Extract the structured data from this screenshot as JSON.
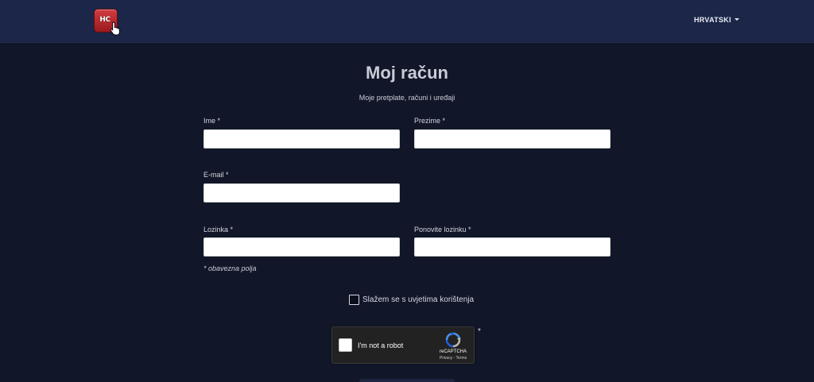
{
  "header": {
    "logo_text": "HC",
    "language_label": "HRVATSKI"
  },
  "page": {
    "title": "Moj račun",
    "subtitle": "Moje pretplate, računi i uređaji"
  },
  "form": {
    "first_name_label": "Ime *",
    "first_name_value": "",
    "last_name_label": "Prezime *",
    "last_name_value": "",
    "email_label": "E-mail *",
    "email_value": "",
    "password_label": "Lozinka *",
    "password_value": "",
    "repeat_password_label": "Ponovite lozinku *",
    "repeat_password_value": "",
    "required_note": "* obavezna polja",
    "terms_label": "Slažem se s uvjetima korištenja",
    "terms_checked": false
  },
  "recaptcha": {
    "label": "I'm not a robot",
    "brand": "reCAPTCHA",
    "links": "Privacy - Terms",
    "required_marker": "*"
  },
  "colors": {
    "background": "#111629",
    "header": "#1b2648",
    "logo": "#b8262b"
  },
  "icons": {
    "logo": "app-logo-icon",
    "cursor": "hand-cursor-icon",
    "caret": "caret-down-icon",
    "recaptcha": "recaptcha-logo-icon"
  }
}
